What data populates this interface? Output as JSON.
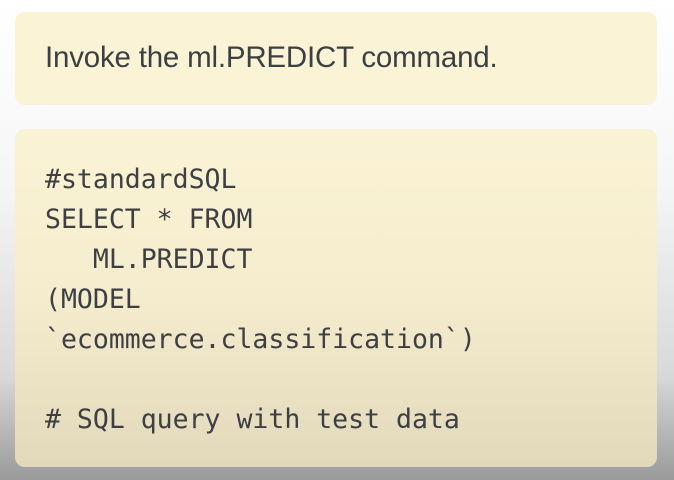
{
  "instruction": {
    "text": "Invoke the ml.PREDICT command."
  },
  "code": {
    "lines": [
      "#standardSQL",
      "SELECT * FROM",
      "   ML.PREDICT",
      "(MODEL",
      "`ecommerce.classification`)",
      "",
      "# SQL query with test data"
    ]
  },
  "colors": {
    "card_background": "#fbf3d5",
    "text": "#3c4043"
  }
}
